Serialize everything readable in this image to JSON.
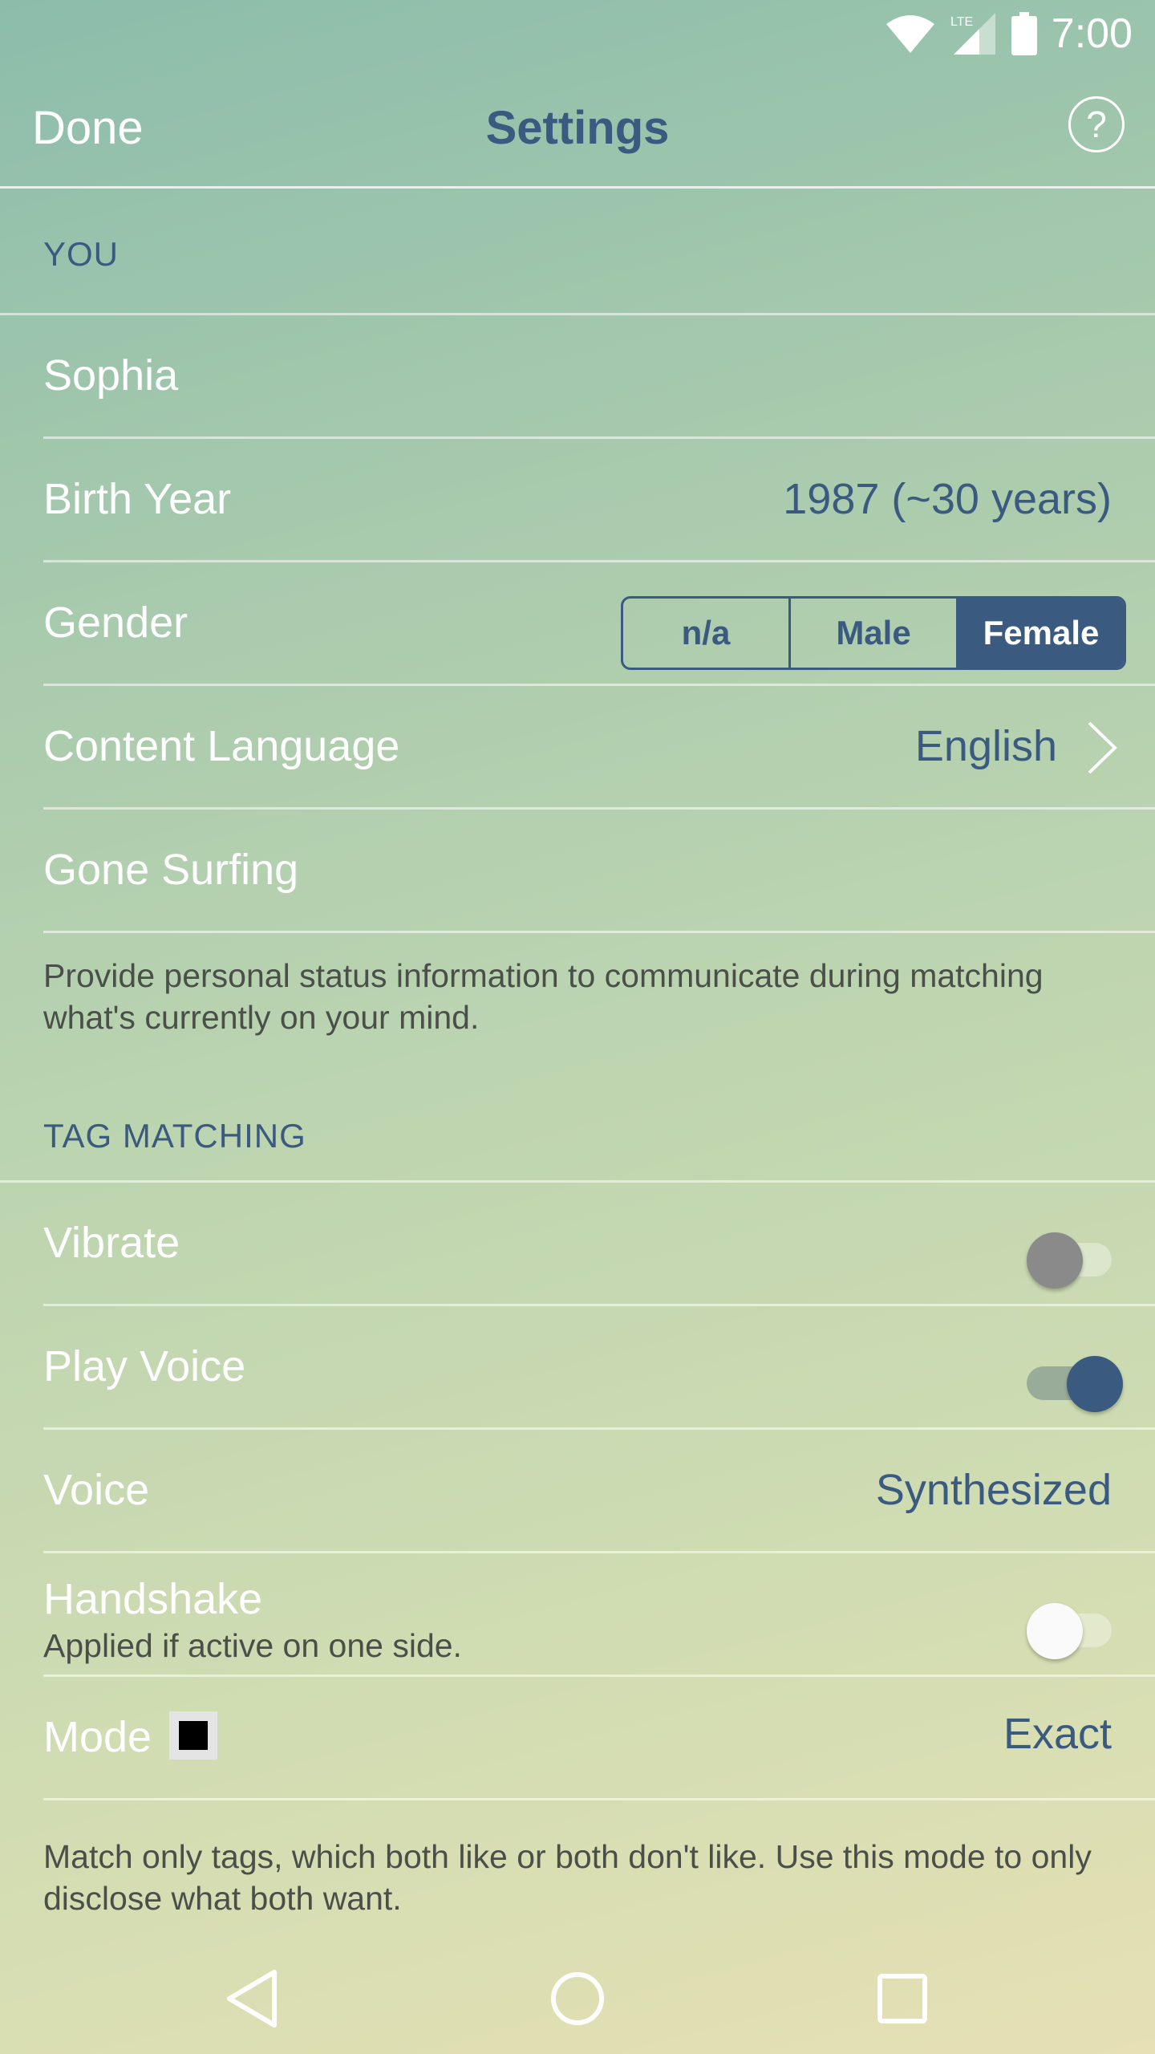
{
  "status": {
    "time": "7:00",
    "network": "LTE"
  },
  "header": {
    "done_label": "Done",
    "title": "Settings",
    "help_label": "?"
  },
  "sections": {
    "you": "YOU",
    "tag_matching": "TAG MATCHING"
  },
  "you": {
    "name": "Sophia",
    "birth_year_label": "Birth Year",
    "birth_year_value": "1987 (~30 years)",
    "gender_label": "Gender",
    "gender_options": [
      "n/a",
      "Male",
      "Female"
    ],
    "gender_selected": "Female",
    "content_language_label": "Content Language",
    "content_language_value": "English",
    "status_text": "Gone Surfing",
    "status_description": "Provide personal status information to communicate during matching what's currently on your mind."
  },
  "tag_matching": {
    "vibrate_label": "Vibrate",
    "vibrate_on": false,
    "play_voice_label": "Play Voice",
    "play_voice_on": true,
    "voice_label": "Voice",
    "voice_value": "Synthesized",
    "handshake_label": "Handshake",
    "handshake_sublabel": "Applied if active on one side.",
    "handshake_on": false,
    "mode_label": "Mode",
    "mode_value": "Exact",
    "mode_description": "Match only tags, which both like or both don't like. Use this mode to only disclose what both want."
  },
  "colors": {
    "accent": "#3a5a80",
    "text_light": "#ffffff",
    "text_dark": "#4a4f4a"
  }
}
